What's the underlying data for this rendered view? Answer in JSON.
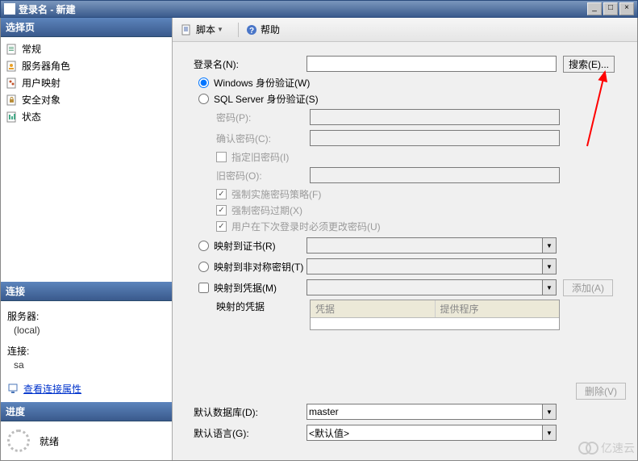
{
  "window": {
    "title": "登录名 - 新建",
    "min": "_",
    "max": "□",
    "close": "×"
  },
  "left": {
    "select_page": "选择页",
    "items": [
      {
        "label": "常规"
      },
      {
        "label": "服务器角色"
      },
      {
        "label": "用户映射"
      },
      {
        "label": "安全对象"
      },
      {
        "label": "状态"
      }
    ],
    "connection_hdr": "连接",
    "server_label": "服务器:",
    "server_value": "(local)",
    "conn_label": "连接:",
    "conn_value": "sa",
    "view_conn_props": "查看连接属性",
    "progress_hdr": "进度",
    "ready": "就绪"
  },
  "toolbar": {
    "script": "脚本",
    "help": "帮助"
  },
  "form": {
    "login_name": "登录名(N):",
    "search_btn": "搜索(E)...",
    "auth_windows": "Windows 身份验证(W)",
    "auth_sql": "SQL Server 身份验证(S)",
    "password": "密码(P):",
    "confirm_password": "确认密码(C):",
    "specify_old": "指定旧密码(I)",
    "old_password": "旧密码(O):",
    "enforce_policy": "强制实施密码策略(F)",
    "enforce_expiry": "强制密码过期(X)",
    "must_change": "用户在下次登录时必须更改密码(U)",
    "map_cert": "映射到证书(R)",
    "map_asym": "映射到非对称密钥(T)",
    "map_cred": "映射到凭据(M)",
    "mapped_creds": "映射的凭据",
    "grid_col1": "凭据",
    "grid_col2": "提供程序",
    "add_btn": "添加(A)",
    "remove_btn": "删除(V)",
    "default_db": "默认数据库(D):",
    "default_db_val": "master",
    "default_lang": "默认语言(G):",
    "default_lang_val": "<默认值>"
  },
  "watermark": "亿速云"
}
